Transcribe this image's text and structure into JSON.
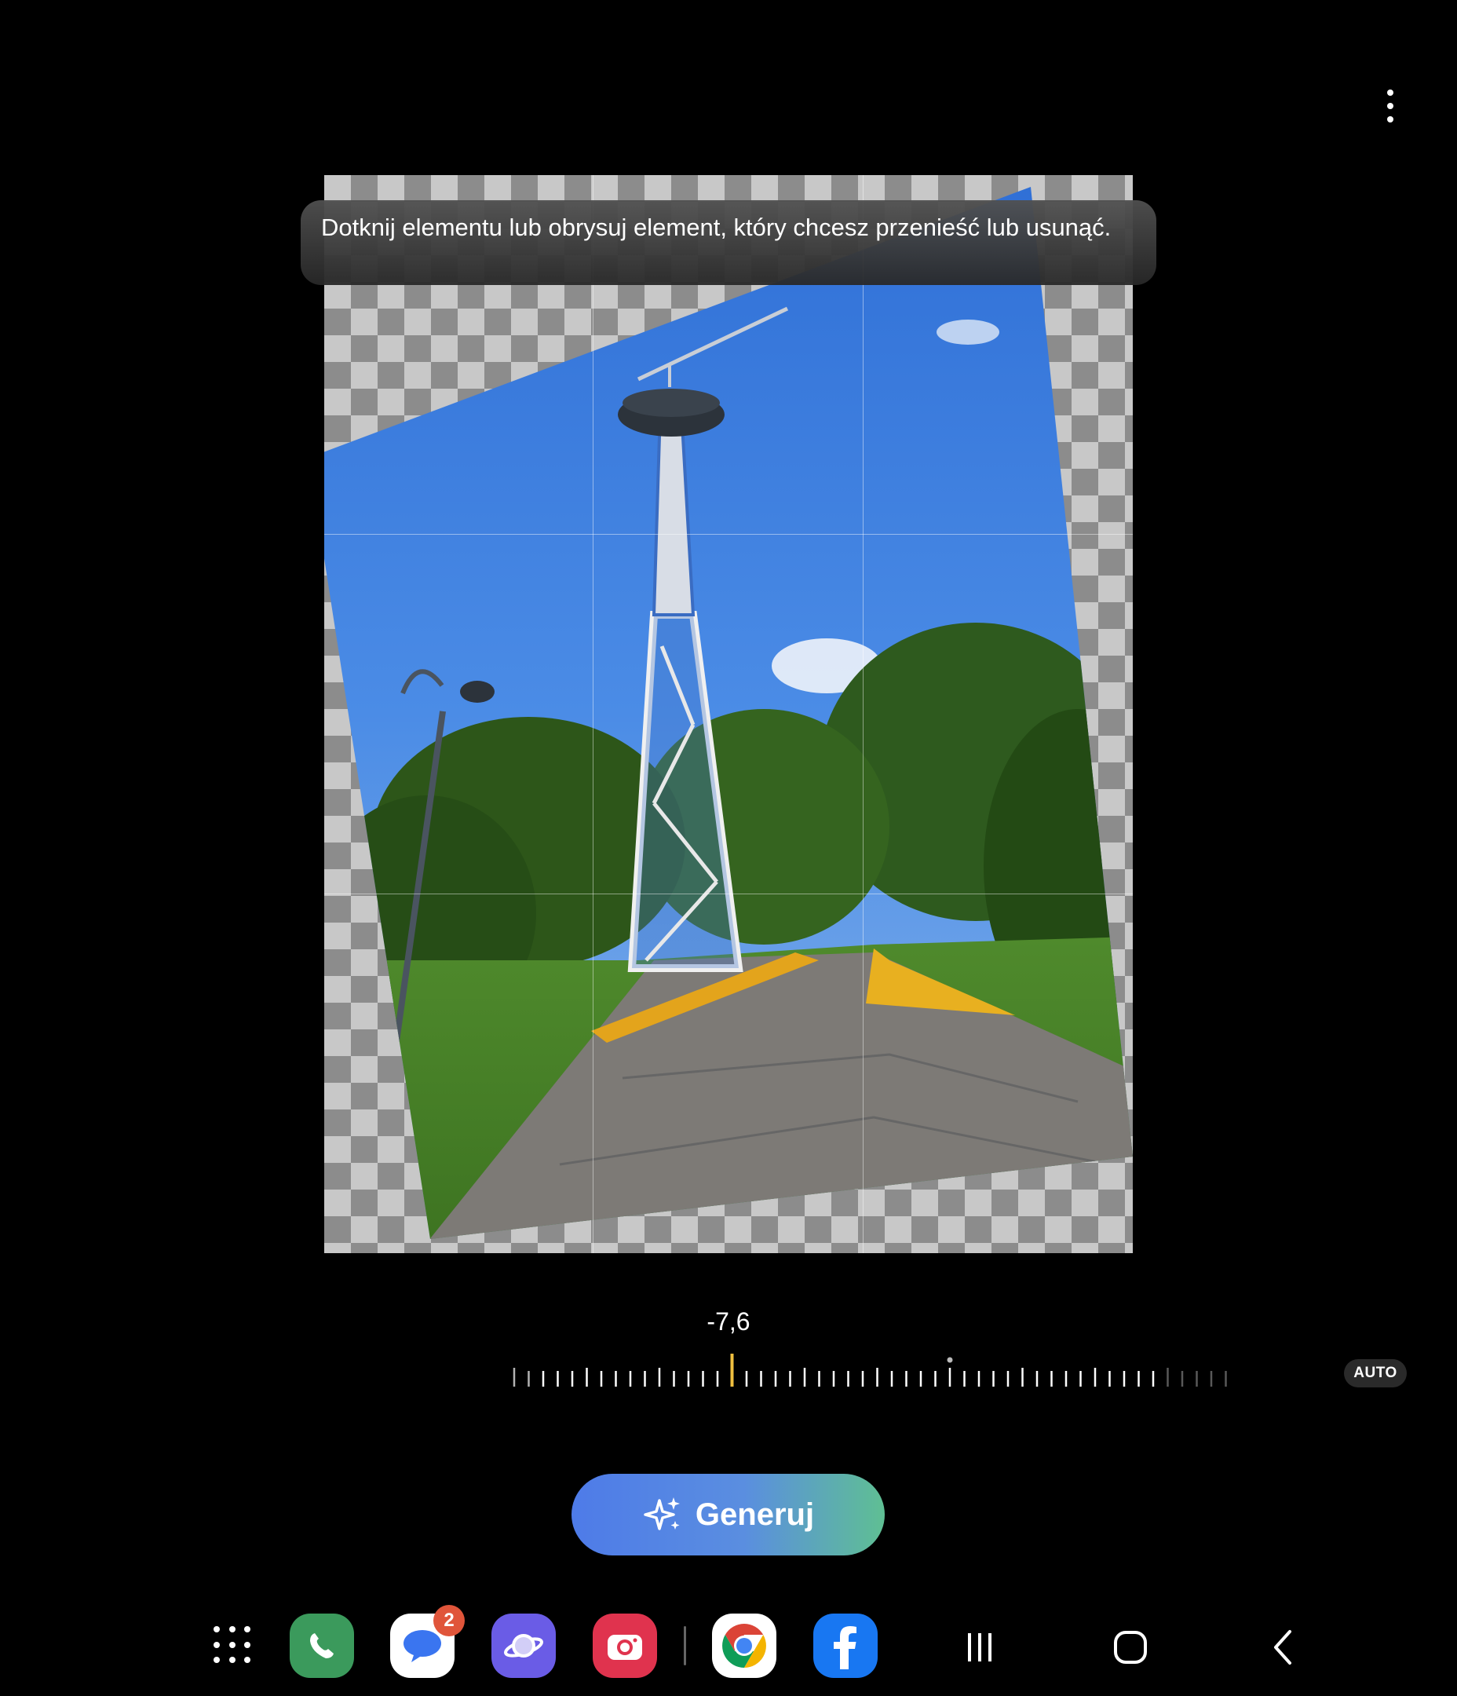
{
  "toolbar": {
    "more_icon": "more-vertical-icon"
  },
  "hint": {
    "text": "Dotknij elementu lub obrysuj element, który chcesz przenieść lub usunąć."
  },
  "straighten": {
    "angle_value": "-7,6",
    "auto_label": "AUTO",
    "indicator_color": "#f0c040"
  },
  "generate": {
    "label": "Generuj",
    "icon": "sparkle-icon",
    "gradient_start": "#4e7be8",
    "gradient_end": "#5fbf93"
  },
  "dock": {
    "apps": [
      {
        "name": "apps-grid-icon"
      },
      {
        "name": "phone-app-icon",
        "color": "#3b9a5c"
      },
      {
        "name": "messages-app-icon",
        "badge": "2",
        "color": "#3a75f0"
      },
      {
        "name": "samsung-internet-app-icon",
        "color": "#6a5ce6"
      },
      {
        "name": "camera-app-icon",
        "color": "#e0334e"
      },
      {
        "name": "chrome-app-icon"
      },
      {
        "name": "facebook-app-icon",
        "color": "#1877f2"
      }
    ],
    "nav": [
      "recents-icon",
      "home-icon",
      "back-icon"
    ]
  }
}
